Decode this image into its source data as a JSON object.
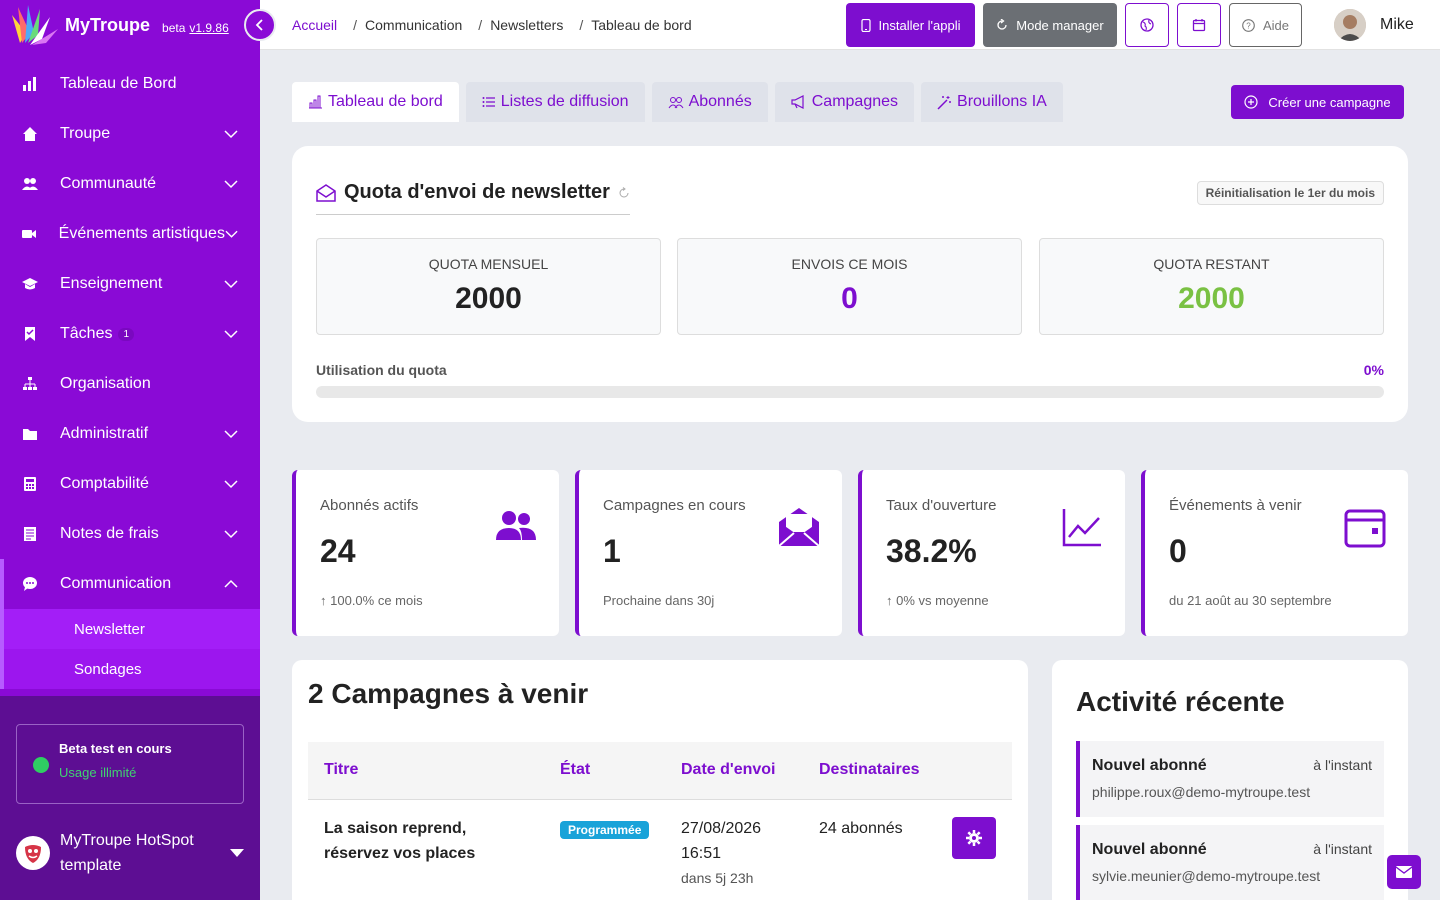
{
  "brand": {
    "name": "MyTroupe",
    "beta": "beta",
    "version": "v1.9.86"
  },
  "sidebar": {
    "items": [
      {
        "label": "Tableau de Bord"
      },
      {
        "label": "Troupe"
      },
      {
        "label": "Communauté"
      },
      {
        "label": "Événements artistiques"
      },
      {
        "label": "Enseignement"
      },
      {
        "label": "Tâches",
        "badge": "1"
      },
      {
        "label": "Organisation"
      },
      {
        "label": "Administratif"
      },
      {
        "label": "Comptabilité"
      },
      {
        "label": "Notes de frais"
      },
      {
        "label": "Communication"
      }
    ],
    "sub_items": [
      {
        "label": "Newsletter"
      },
      {
        "label": "Sondages"
      }
    ],
    "beta_box": {
      "title": "Beta test en cours",
      "subtitle": "Usage illimité"
    },
    "org": {
      "name": "MyTroupe HotSpot template"
    }
  },
  "breadcrumb": [
    "Accueil",
    "Communication",
    "Newsletters",
    "Tableau de bord"
  ],
  "topbar": {
    "install": "Installer l'appli",
    "manager": "Mode manager",
    "help": "Aide",
    "user": "Mike"
  },
  "tabs": [
    "Tableau de bord",
    "Listes de diffusion",
    "Abonnés",
    "Campagnes",
    "Brouillons IA"
  ],
  "create_campaign": "Créer une campagne",
  "quota": {
    "title": "Quota d'envoi de newsletter",
    "reset": "Réinitialisation le 1er du mois",
    "boxes": [
      {
        "label": "QUOTA MENSUEL",
        "value": "2000",
        "color": "#222222"
      },
      {
        "label": "ENVOIS CE MOIS",
        "value": "0",
        "color": "#7d0ecf"
      },
      {
        "label": "QUOTA RESTANT",
        "value": "2000",
        "color": "#7ac143"
      }
    ],
    "usage_label": "Utilisation du quota",
    "usage_pct": "0%",
    "usage_fraction": 0
  },
  "stats": [
    {
      "label": "Abonnés actifs",
      "value": "24",
      "sub": "100.0% ce mois",
      "icon": "users-icon"
    },
    {
      "label": "Campagnes en cours",
      "value": "1",
      "sub": "Prochaine dans 30j",
      "icon": "envelope-open-icon"
    },
    {
      "label": "Taux d'ouverture",
      "value": "38.2%",
      "sub": "0% vs moyenne",
      "icon": "chart-line-icon"
    },
    {
      "label": "Événements à venir",
      "value": "0",
      "sub": "du 21 août au 30 septembre",
      "icon": "calendar-icon"
    }
  ],
  "campaigns": {
    "title": "2 Campagnes à venir",
    "columns": [
      "Titre",
      "État",
      "Date d'envoi",
      "Destinataires"
    ],
    "rows": [
      {
        "title_l1": "La saison reprend,",
        "title_l2": "réservez vos places",
        "state": "Programmée",
        "date": "27/08/2026",
        "time": "16:51",
        "rel": "dans 5j 23h",
        "recipients": "24 abonnés"
      }
    ]
  },
  "activity": {
    "title": "Activité récente",
    "items": [
      {
        "title": "Nouvel abonné",
        "when": "à l'instant",
        "email": "philippe.roux@demo-mytroupe.test"
      },
      {
        "title": "Nouvel abonné",
        "when": "à l'instant",
        "email": "sylvie.meunier@demo-mytroupe.test"
      }
    ]
  },
  "colors": {
    "accent": "#7d0ecf",
    "sidebar": "#8a0ad6",
    "success": "#7ac143",
    "info": "#19a3d9"
  }
}
